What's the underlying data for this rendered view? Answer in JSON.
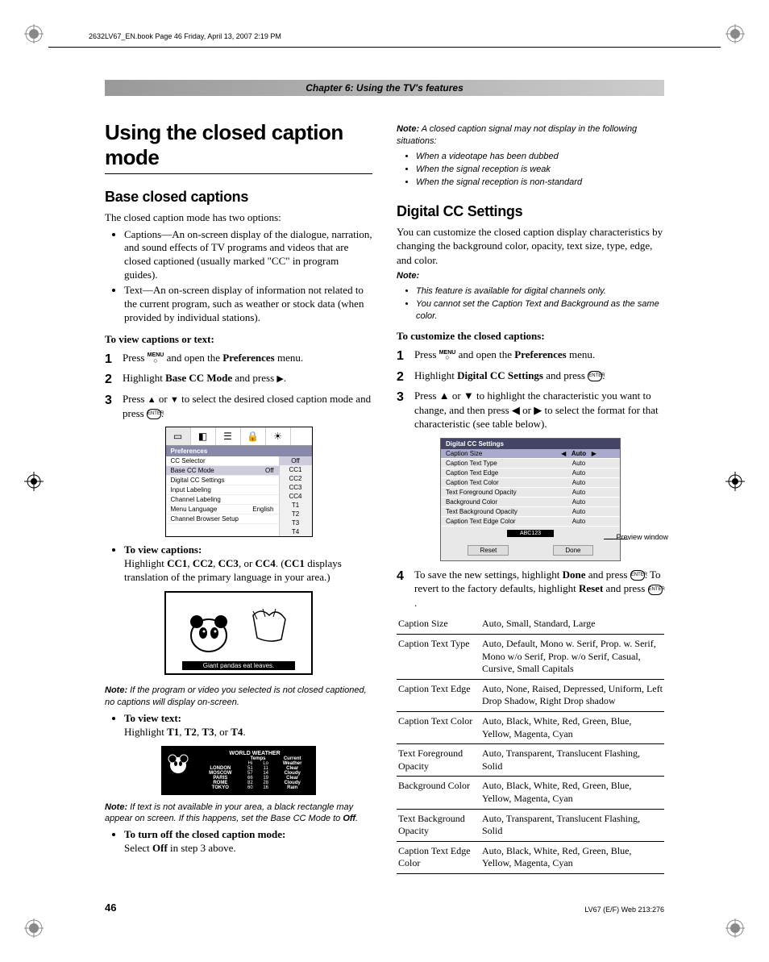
{
  "labels": {
    "note": "Note:"
  },
  "header": {
    "print_line": "2632LV67_EN.book  Page 46  Friday, April 13, 2007  2:19 PM",
    "chapter": "Chapter 6: Using the TV's features"
  },
  "left": {
    "h1": "Using the closed caption mode",
    "h2a": "Base closed captions",
    "intro": "The closed caption mode has two options:",
    "opts": [
      "Captions—An on-screen display of the dialogue, narration, and sound effects of TV programs and videos that are closed captioned (usually marked \"CC\" in program guides).",
      "Text—An on-screen display of information not related to the current program, such as weather or stock data (when provided by individual stations)."
    ],
    "proc1_title": "To view captions or text:",
    "menu_pref": "Preferences",
    "base_cc": "Base CC Mode",
    "ui": {
      "title": "Preferences",
      "rows": [
        "CC Selector",
        "Base CC Mode",
        "Digital CC Settings",
        "Input Labeling",
        "Channel Labeling",
        "Menu Language",
        "Channel Browser Setup"
      ],
      "off": "Off",
      "english": "English",
      "opts": [
        "Off",
        "CC1",
        "CC2",
        "CC3",
        "CC4",
        "T1",
        "T2",
        "T3",
        "T4"
      ]
    },
    "view_cap_h": "To view captions:",
    "view_cap_t1": "Highlight",
    "view_cap_t2": "displays translation of the primary language in your area.)",
    "panda_cap": "Giant pandas eat leaves.",
    "note1": "If the program or video you selected is not closed captioned, no captions will display on-screen.",
    "view_txt_h": "To view text:",
    "view_txt_t": "Highlight",
    "weather": {
      "title": "WORLD WEATHER",
      "rows": [
        {
          "c": "LONDON",
          "h": "51",
          "l": "11",
          "w": "Clear"
        },
        {
          "c": "MOSCOW",
          "h": "57",
          "l": "14",
          "w": "Cloudy"
        },
        {
          "c": "PARIS",
          "h": "66",
          "l": "19",
          "w": "Clear"
        },
        {
          "c": "ROME",
          "h": "82",
          "l": "28",
          "w": "Cloudy"
        },
        {
          "c": "TOKYO",
          "h": "60",
          "l": "16",
          "w": "Rain"
        }
      ]
    },
    "note2a": "If text is not available in your area, a black rectangle may appear on screen. If this happens, set the Base CC Mode to",
    "note2b": "Off",
    "off_h": "To turn off the closed caption mode:",
    "off_t1": "Select",
    "off_b": "Off",
    "off_t2": "in step 3 above."
  },
  "right": {
    "note_top": "A closed caption signal may not display in the following situations:",
    "note_items": [
      "When a videotape has been dubbed",
      "When the signal reception is weak",
      "When the signal reception is non-standard"
    ],
    "h2": "Digital CC Settings",
    "intro": "You can customize the closed caption display characteristics by changing the background color, opacity, text size, type, edge, and color.",
    "note2": [
      "This feature is available for digital channels only.",
      "You cannot set the Caption Text and Background as the same color."
    ],
    "proc_title": "To customize the closed captions:",
    "dcc": "Digital CC Settings",
    "step3": "Press ▲ or ▼ to highlight the characteristic you want to change, and then press ◀ or ▶ to select the format for that characteristic (see table below).",
    "ui": {
      "title": "Digital CC Settings",
      "rows": [
        "Caption Size",
        "Caption Text Type",
        "Caption Text Edge",
        "Caption Text Color",
        "Text Foreground Opacity",
        "Background Color",
        "Text Background Opacity",
        "Caption Text Edge Color"
      ],
      "auto": "Auto",
      "preview": "ABC123",
      "reset": "Reset",
      "done": "Done",
      "preview_label": "Preview window"
    },
    "table": [
      {
        "k": "Caption Size",
        "v": "Auto, Small, Standard, Large"
      },
      {
        "k": "Caption Text Type",
        "v": "Auto, Default, Mono w. Serif, Prop. w. Serif, Mono w/o Serif, Prop. w/o Serif, Casual, Cursive, Small Capitals"
      },
      {
        "k": "Caption Text Edge",
        "v": "Auto, None, Raised, Depressed, Uniform, Left Drop Shadow, Right Drop shadow"
      },
      {
        "k": "Caption Text Color",
        "v": "Auto, Black, White, Red, Green, Blue, Yellow, Magenta, Cyan"
      },
      {
        "k": "Text Foreground Opacity",
        "v": "Auto, Transparent, Translucent Flashing, Solid"
      },
      {
        "k": "Background Color",
        "v": "Auto, Black, White, Red, Green, Blue, Yellow, Magenta, Cyan"
      },
      {
        "k": "Text Background Opacity",
        "v": "Auto, Transparent, Translucent Flashing, Solid"
      },
      {
        "k": "Caption Text Edge Color",
        "v": "Auto, Black, White, Red, Green, Blue, Yellow, Magenta, Cyan"
      }
    ]
  },
  "footer": {
    "page": "46",
    "code": "LV67 (E/F) Web 213:276"
  }
}
